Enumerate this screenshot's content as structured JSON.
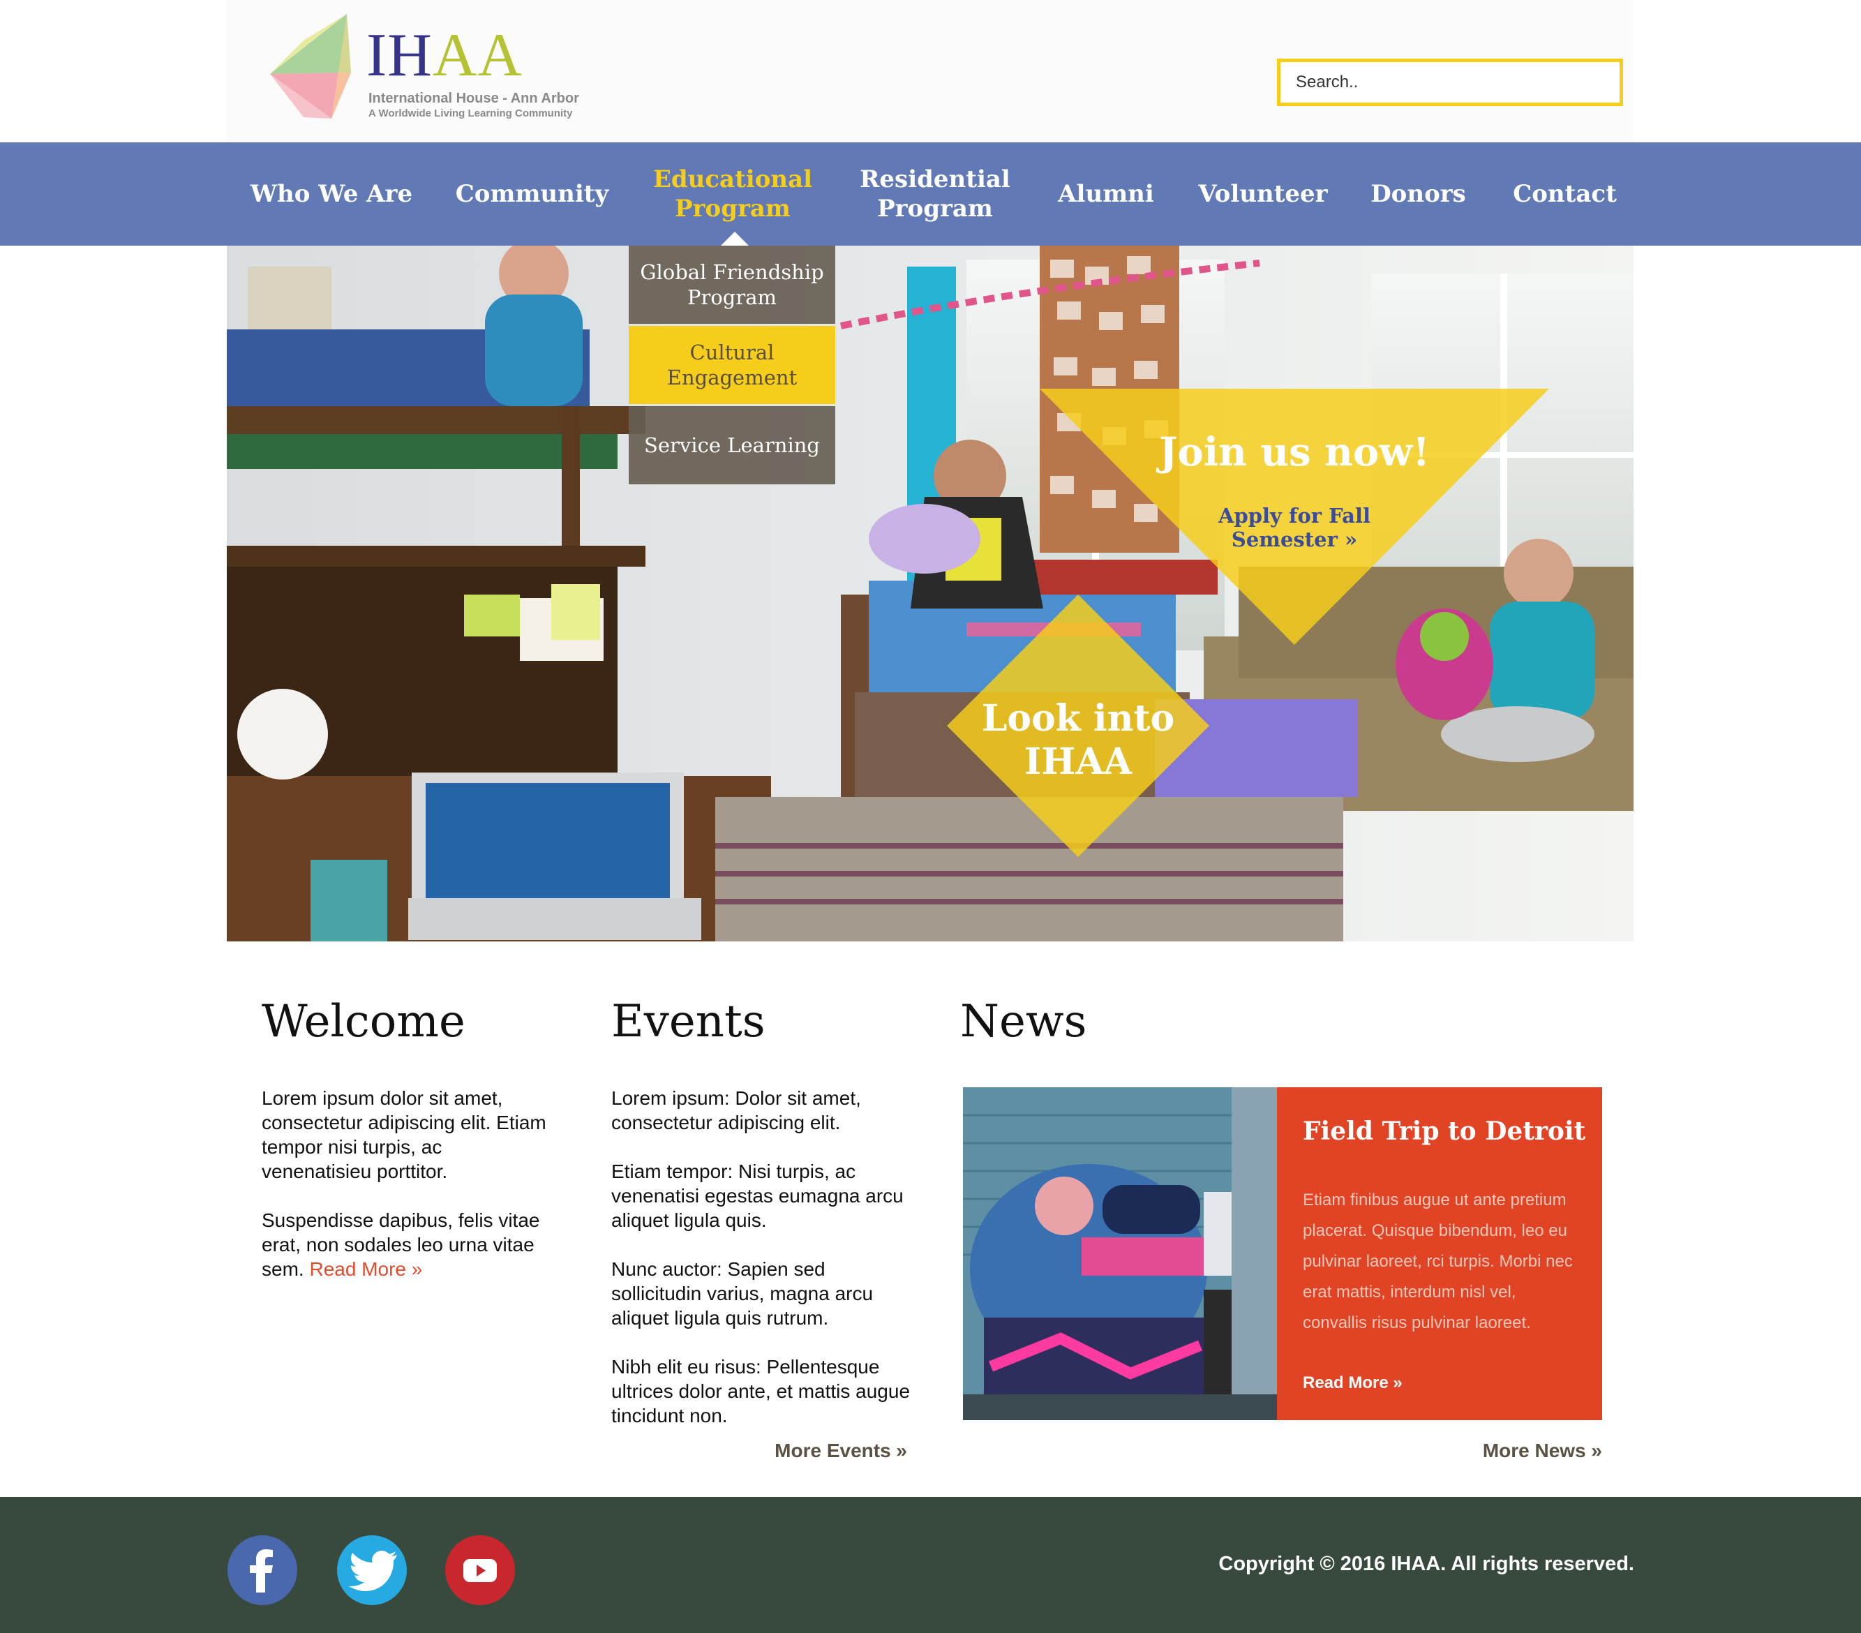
{
  "header": {
    "logo": {
      "mark": "IH",
      "mark_accent": "AA",
      "line1": "International House - Ann Arbor",
      "line2": "A Worldwide Living Learning Community"
    },
    "search": {
      "placeholder": "Search.."
    }
  },
  "nav": {
    "items": [
      {
        "label": "Who We Are"
      },
      {
        "label": "Community"
      },
      {
        "label": "Educational Program",
        "active": true
      },
      {
        "label": "Residential Program"
      },
      {
        "label": "Alumni"
      },
      {
        "label": "Volunteer"
      },
      {
        "label": "Donors"
      },
      {
        "label": "Contact"
      }
    ],
    "dropdown": [
      {
        "label": "Global Friendship Program"
      },
      {
        "label": "Cultural Engagement",
        "highlighted": true
      },
      {
        "label": "Service Learning"
      }
    ]
  },
  "hero": {
    "join": {
      "title": "Join us now!",
      "link": "Apply for Fall Semester »"
    },
    "look": {
      "title": "Look into IHAA"
    }
  },
  "welcome": {
    "title": "Welcome",
    "p1": "Lorem ipsum dolor sit amet, consectetur adipiscing elit. Etiam tempor nisi turpis, ac venenatisieu porttitor.",
    "p2": "Suspendisse dapibus, felis vitae erat, non sodales leo urna vitae sem.",
    "read_more": "Read More »"
  },
  "events": {
    "title": "Events",
    "items": [
      "Lorem ipsum: Dolor sit amet, consectetur adipiscing elit.",
      "Etiam tempor: Nisi turpis, ac venenatisi egestas eumagna arcu aliquet ligula quis.",
      "Nunc auctor: Sapien sed sollicitudin varius, magna arcu aliquet ligula quis rutrum.",
      "Nibh elit eu risus: Pellentesque ultrices dolor ante, et mattis augue tincidunt non."
    ],
    "more": "More Events »"
  },
  "news": {
    "title": "News",
    "card": {
      "title": "Field Trip to Detroit",
      "text": "Etiam finibus augue ut ante pretium placerat. Quisque bibendum, leo eu pulvinar laoreet, rci turpis. Morbi nec erat mattis, interdum nisl vel, convallis risus pulvinar laoreet.",
      "read_more": "Read More »"
    },
    "more": "More News »"
  },
  "footer": {
    "social": [
      {
        "name": "facebook-icon",
        "glyph": "f",
        "color": "#4a68ad"
      },
      {
        "name": "twitter-icon",
        "color": "#27aae1"
      },
      {
        "name": "youtube-icon",
        "color": "#c8282d"
      }
    ],
    "copyright": "Copyright © 2016 IHAA. All rights reserved."
  },
  "colors": {
    "nav_bg": "#6179b5",
    "accent_yellow": "#f5cd1a",
    "accent_red": "#e14425",
    "footer_bg": "#384a3e",
    "logo_blue": "#35338a",
    "logo_green": "#b4c233"
  }
}
